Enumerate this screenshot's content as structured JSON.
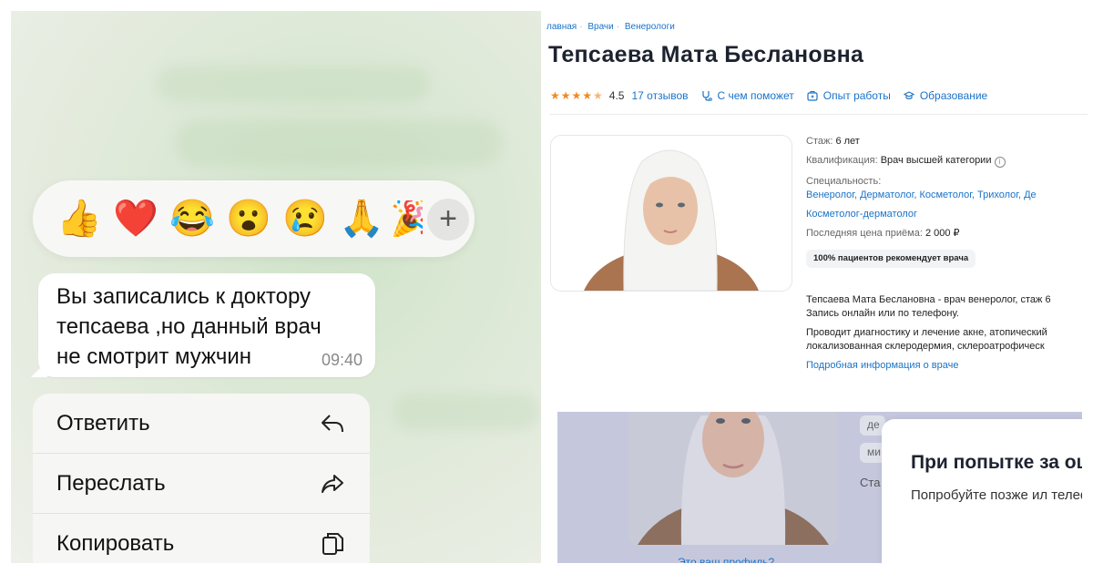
{
  "chat": {
    "reactions": [
      "👍",
      "❤️",
      "😂",
      "😮",
      "😢",
      "🙏",
      "🎉"
    ],
    "reaction_add": "+",
    "message": {
      "text": "Вы записались к доктору тепсаева ,но данный врач не смотрит мужчин",
      "time": "09:40"
    },
    "menu": [
      {
        "label": "Ответить",
        "icon": "reply-icon"
      },
      {
        "label": "Переслать",
        "icon": "forward-icon"
      },
      {
        "label": "Копировать",
        "icon": "copy-icon"
      }
    ]
  },
  "doctor_page": {
    "breadcrumbs": [
      "лавная",
      "Врачи",
      "Венерологи"
    ],
    "name": "Тепсаева Мата Беслановна",
    "rating": "4.5",
    "rating_stars": 4.5,
    "reviews": "17 отзывов",
    "tabs": [
      "С чем поможет",
      "Опыт работы",
      "Образование"
    ],
    "experience_label": "Стаж:",
    "experience_value": "6 лет",
    "qualification_label": "Квалификация:",
    "qualification_value": "Врач высшей категории",
    "specialties_label": "Специальность:",
    "specialties_line1": "Венеролог, Дерматолог, Косметолог, Трихолог, Де",
    "specialties_line2": "Косметолог-дерматолог",
    "price_label": "Последняя цена приёма:",
    "price_value": "2 000 ₽",
    "recommend_badge": "100% пациентов рекомендует врача",
    "desc_line1": "Тепсаева Мата Беслановна - врач венеролог, стаж 6",
    "desc_line2": "Запись онлайн или по телефону.",
    "desc_line3": "Проводит диагностику и лечение акне, атопический",
    "desc_line4": "локализованная склеродермия, склероатрофическ",
    "more_link": "Подробная информация о враче"
  },
  "error_modal": {
    "chips": [
      "де",
      "ми"
    ],
    "sta": "Ста",
    "profile_link": "Это ваш профиль?",
    "title": "При попытке за ошибка",
    "subtitle": "Попробуйте позже ил телефону"
  },
  "colors": {
    "link": "#1a73c8",
    "star": "#f08a24",
    "chat_bg": "#dbe8d5",
    "modal_backdrop": "#c5c8dd"
  }
}
